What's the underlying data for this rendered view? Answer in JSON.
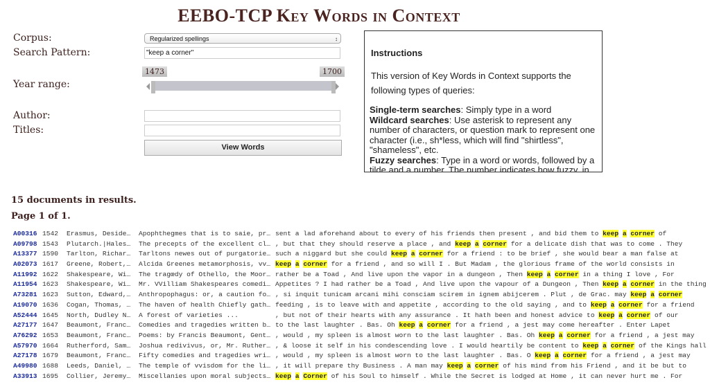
{
  "title": "EEBO-TCP Key Words in Context",
  "form": {
    "corpus_label": "Corpus:",
    "corpus_value": "Regularized spellings",
    "search_label": "Search Pattern:",
    "search_value": "\"keep a corner\"",
    "year_label": "Year range:",
    "year_min": "1473",
    "year_max": "1700",
    "author_label": "Author:",
    "author_value": "",
    "titles_label": "Titles:",
    "titles_value": "",
    "submit_label": "View Words"
  },
  "instructions": {
    "heading": "Instructions",
    "intro": "This version of Key Words in Context supports the following types of queries:",
    "items": [
      {
        "term": "Single-term searches",
        "text": ": Simply type in a word"
      },
      {
        "term": "Wildcard searches",
        "text": ": Use asterisk to represent any number of characters, or question mark to represent one character (i.e., sh*less, which will find \"shirtless\", \"shameless\", etc."
      },
      {
        "term": "Fuzzy searches",
        "text": ": Type in a word or words, followed by a tilde and a number. The number indicates how fuzzy, in"
      }
    ]
  },
  "results": {
    "count_text": "15 documents in results.",
    "page_text": "Page 1 of 1.",
    "keyword": [
      "keep",
      "a",
      "corner"
    ],
    "rows": [
      {
        "id": "A00316",
        "year": "1542",
        "author": "Erasmus, Deside…",
        "title": "Apophthegmes that is to saie, pr…",
        "left": "sent a lad aforehand about to every of his friends then present , and bid them to ",
        "kw": [
          "keep",
          "a",
          "corner"
        ],
        "right": " of"
      },
      {
        "id": "A09798",
        "year": "1543",
        "author": "Plutarch.|Hales…",
        "title": "The precepts of the excellent cl…",
        "left": ", but that they should reserve a place , and ",
        "kw": [
          "keep",
          "a",
          "corner"
        ],
        "right": " for a delicate dish that was to come . They"
      },
      {
        "id": "A13377",
        "year": "1590",
        "author": "Tarlton, Richar…",
        "title": "Tarltons newes out of purgatorie…",
        "left": "such a niggard but she could ",
        "kw": [
          "keep",
          "a",
          "corner"
        ],
        "right": " for a friend : to be brief , she would bear a man false at"
      },
      {
        "id": "A02073",
        "year": "1617",
        "author": "Greene, Robert,…",
        "title": "Alcida Greenes metamorphosis, vv…",
        "left": "",
        "kw": [
          "keep",
          "a",
          "corner"
        ],
        "right": " for a friend , and so will I . But Madam , the glorious frame of the world consists in"
      },
      {
        "id": "A11992",
        "year": "1622",
        "author": "Shakespeare, Wi…",
        "title": "The tragœdy of Othello, the Moor…",
        "left": "rather be a Toad , And live upon the vapor in a dungeon , Then ",
        "kw": [
          "keep",
          "a",
          "corner"
        ],
        "right": " in a thing I love , For"
      },
      {
        "id": "A11954",
        "year": "1623",
        "author": "Shakespeare, Wi…",
        "title": "Mr. VVilliam Shakespeares comedi…",
        "left": "Appetites ? I had rather be a Toad , And live upon the vapour of a Dungeon , Then ",
        "kw": [
          "keep",
          "a",
          "corner"
        ],
        "right": " in the thing"
      },
      {
        "id": "A73281",
        "year": "1623",
        "author": "Sutton, Edward,…",
        "title": "Anthropophagus: or, a caution fo…",
        "left": ", si inquit tunicam arcani mihi consciam scirem in ignem abijcerem . Plut , de Grac. may ",
        "kw": [
          "keep",
          "a",
          "corner"
        ],
        "right": ""
      },
      {
        "id": "A19070",
        "year": "1636",
        "author": "Cogan, Thomas, …",
        "title": "The haven of health Chiefly gath…",
        "left": "feeding , is to leave with and appetite , according to the old saying , and to ",
        "kw": [
          "keep",
          "a",
          "corner"
        ],
        "right": " for a friend"
      },
      {
        "id": "A52444",
        "year": "1645",
        "author": "North, Dudley N…",
        "title": "A forest of varieties ...",
        "left": ", but not of their hearts with any assurance . It hath been and honest advice to ",
        "kw": [
          "keep",
          "a",
          "corner"
        ],
        "right": " of our"
      },
      {
        "id": "A27177",
        "year": "1647",
        "author": "Beaumont, Franc…",
        "title": "Comedies and tragedies written b…",
        "left": "to the last laughter . Bas. Oh ",
        "kw": [
          "keep",
          "a",
          "corner"
        ],
        "right": " for a friend , a jest may come hereafter . Enter Lapet"
      },
      {
        "id": "A76292",
        "year": "1653",
        "author": "Beaumont, Franc…",
        "title": "Poems: by Francis Beaumont, Gent…",
        "left": ", would , my spleen is almost worn to the last laughter . Bas. Oh ",
        "kw": [
          "keep",
          "a",
          "corner"
        ],
        "right": " for a friend , a jest may"
      },
      {
        "id": "A57970",
        "year": "1664",
        "author": "Rutherford, Sam…",
        "title": "Joshua redivivus, or, Mr. Ruther…",
        "left": ", & loose it self in his condescending love . I would heartily be content to ",
        "kw": [
          "keep",
          "a",
          "corner"
        ],
        "right": " of the Kings hall"
      },
      {
        "id": "A27178",
        "year": "1679",
        "author": "Beaumont, Franc…",
        "title": "Fifty comedies and tragedies wri…",
        "left": ", would , my spleen is almost worn to the last laughter . Bas. O ",
        "kw": [
          "keep",
          "a",
          "corner"
        ],
        "right": " for a friend , a jest may"
      },
      {
        "id": "A49980",
        "year": "1688",
        "author": "Leeds, Daniel, …",
        "title": "The temple of vvisdom for the li…",
        "left": ", it will prepare thy Business . A man may ",
        "kw": [
          "keep",
          "a",
          "corner"
        ],
        "right": " of his mind from his Friend , and it be but to"
      },
      {
        "id": "A33913",
        "year": "1695",
        "author": "Collier, Jeremy…",
        "title": "Miscellanies upon moral subjects…",
        "left": "",
        "kw": [
          "keep",
          "a",
          "Corner"
        ],
        "right": " of his Soul to himself . While the Secret is lodged at Home , it can never hurt me . For"
      }
    ]
  }
}
